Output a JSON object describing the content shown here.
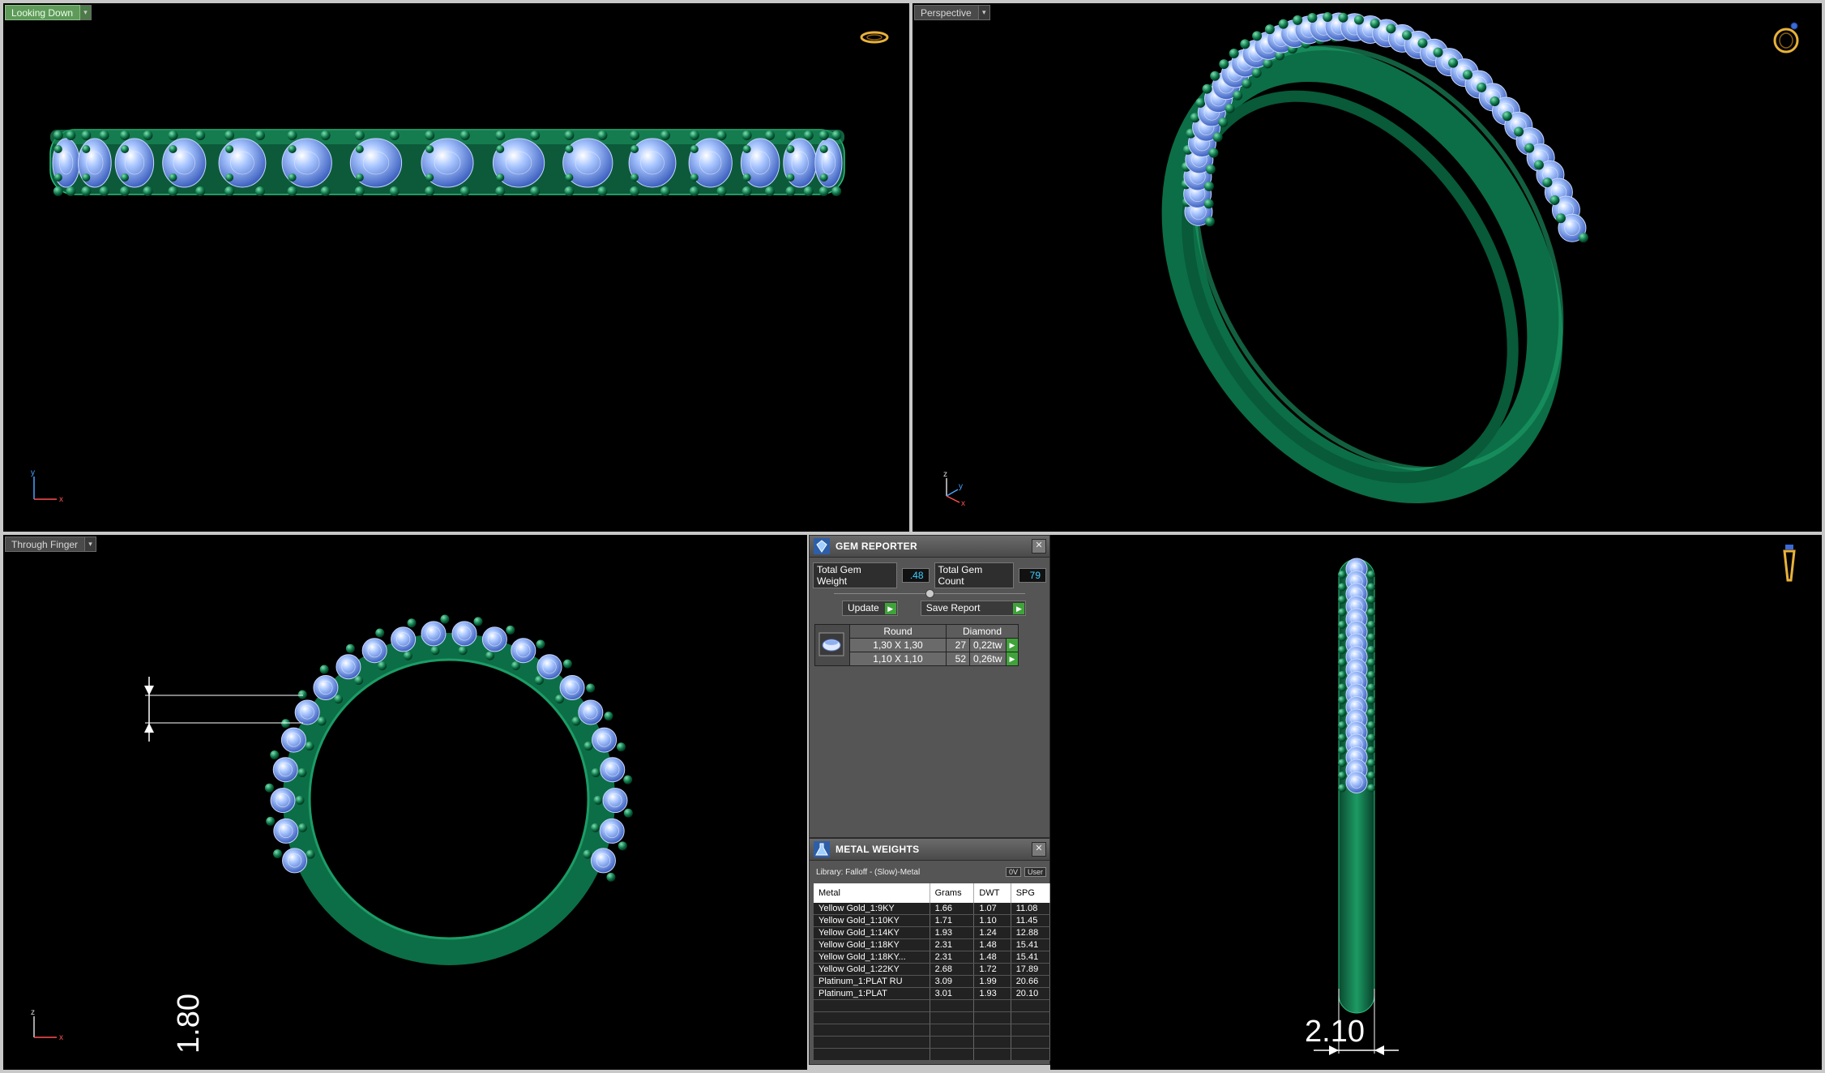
{
  "viewports": {
    "top_left": {
      "label": "Looking Down"
    },
    "top_right": {
      "label": "Perspective"
    },
    "bottom_left": {
      "label": "Through Finger",
      "dimension": "1.80"
    },
    "bottom_right": {
      "dimension": "2.10"
    }
  },
  "axes": {
    "x": "x",
    "y": "y",
    "z": "z"
  },
  "gem_reporter": {
    "title": "GEM REPORTER",
    "total_weight_label": "Total Gem Weight",
    "total_weight_value": ".48",
    "total_count_label": "Total Gem Count",
    "total_count_value": "79",
    "update_label": "Update",
    "save_label": "Save Report",
    "header": {
      "shape": "Round",
      "material": "Diamond"
    },
    "rows": [
      {
        "size": "1,30 X 1,30",
        "count": "27",
        "weight": "0,22tw"
      },
      {
        "size": "1,10 X 1,10",
        "count": "52",
        "weight": "0,26tw"
      }
    ]
  },
  "metal_weights": {
    "title": "METAL WEIGHTS",
    "library": "Library: Falloff - (Slow)-Metal",
    "chip1": "0V",
    "chip2": "User",
    "columns": [
      "Metal",
      "Grams",
      "DWT",
      "SPG"
    ],
    "rows": [
      [
        "Yellow Gold_1:9KY",
        "1.66",
        "1.07",
        "11.08"
      ],
      [
        "Yellow Gold_1:10KY",
        "1.71",
        "1.10",
        "11.45"
      ],
      [
        "Yellow Gold_1:14KY",
        "1.93",
        "1.24",
        "12.88"
      ],
      [
        "Yellow Gold_1:18KY",
        "2.31",
        "1.48",
        "15.41"
      ],
      [
        "Yellow Gold_1:18KY...",
        "2.31",
        "1.48",
        "15.41"
      ],
      [
        "Yellow Gold_1:22KY",
        "2.68",
        "1.72",
        "17.89"
      ],
      [
        "Platinum_1:PLAT RU",
        "3.09",
        "1.99",
        "20.66"
      ],
      [
        "Platinum_1:PLAT",
        "3.01",
        "1.93",
        "20.10"
      ]
    ]
  },
  "colors": {
    "metal": "#0c6e46",
    "gem": "#8fb4f0",
    "prong": "#1a8a5a",
    "active": "#5f9a5a"
  }
}
